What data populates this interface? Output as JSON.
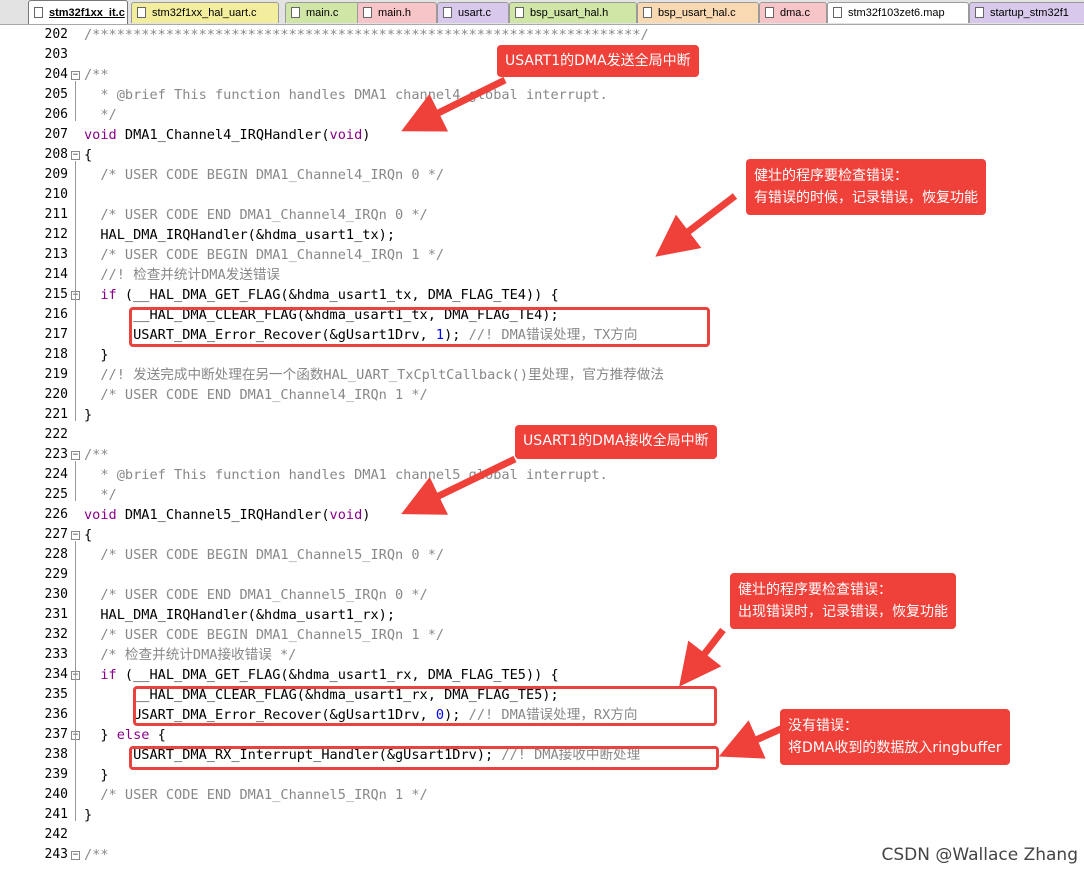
{
  "tabs": [
    {
      "label": "stm32f1xx_it.c",
      "active": true,
      "color": "#ffffff"
    },
    {
      "label": "stm32f1xx_hal_uart.c",
      "active": false,
      "color": "#f3ee9d"
    },
    {
      "label": "main.c",
      "active": false,
      "color": "#cfe6a6"
    },
    {
      "label": "main.h",
      "active": false,
      "color": "#f7c4c8"
    },
    {
      "label": "usart.c",
      "active": false,
      "color": "#d8c8ec"
    },
    {
      "label": "bsp_usart_hal.h",
      "active": false,
      "color": "#cfe6a6"
    },
    {
      "label": "bsp_usart_hal.c",
      "active": false,
      "color": "#f9d9b2"
    },
    {
      "label": "dma.c",
      "active": false,
      "color": "#f7c4c8"
    },
    {
      "label": "stm32f103zet6.map",
      "active": false,
      "color": "#ffffff"
    },
    {
      "label": "startup_stm32f1",
      "active": false,
      "color": "#d8c8ec"
    }
  ],
  "lines": [
    {
      "n": "202",
      "t": [
        [
          "cm",
          "/*******************************************************************/"
        ]
      ]
    },
    {
      "n": "203",
      "t": []
    },
    {
      "n": "204",
      "t": [
        [
          "cm",
          "/**"
        ]
      ],
      "fold": true
    },
    {
      "n": "205",
      "t": [
        [
          "cm",
          "  * @brief This function handles DMA1 channel4 global interrupt."
        ]
      ]
    },
    {
      "n": "206",
      "t": [
        [
          "cm",
          "  */"
        ]
      ]
    },
    {
      "n": "207",
      "t": [
        [
          "kw",
          "void"
        ],
        [
          "",
          " DMA1_Channel4_IRQHandler("
        ],
        [
          "kw",
          "void"
        ],
        [
          "",
          ")"
        ]
      ]
    },
    {
      "n": "208",
      "t": [
        [
          "",
          "{"
        ]
      ],
      "fold": true
    },
    {
      "n": "209",
      "t": [
        [
          "cm",
          "  /* USER CODE BEGIN DMA1_Channel4_IRQn 0 */"
        ]
      ]
    },
    {
      "n": "210",
      "t": []
    },
    {
      "n": "211",
      "t": [
        [
          "cm",
          "  /* USER CODE END DMA1_Channel4_IRQn 0 */"
        ]
      ]
    },
    {
      "n": "212",
      "t": [
        [
          "",
          "  HAL_DMA_IRQHandler(&hdma_usart1_tx);"
        ]
      ]
    },
    {
      "n": "213",
      "t": [
        [
          "cm",
          "  /* USER CODE BEGIN DMA1_Channel4_IRQn 1 */"
        ]
      ]
    },
    {
      "n": "214",
      "t": [
        [
          "cm",
          "  //! 检查并统计DMA发送错误"
        ]
      ]
    },
    {
      "n": "215",
      "t": [
        [
          "kw",
          "  if"
        ],
        [
          "",
          " (__HAL_DMA_GET_FLAG(&hdma_usart1_tx, DMA_FLAG_TE4)) {"
        ]
      ],
      "fold": true
    },
    {
      "n": "216",
      "t": [
        [
          "",
          "      __HAL_DMA_CLEAR_FLAG(&hdma_usart1_tx, DMA_FLAG_TE4);"
        ]
      ]
    },
    {
      "n": "217",
      "t": [
        [
          "",
          "      USART_DMA_Error_Recover(&gUsart1Drv, "
        ],
        [
          "num",
          "1"
        ],
        [
          "",
          "); "
        ],
        [
          "cm",
          "//! DMA错误处理，TX方向"
        ]
      ]
    },
    {
      "n": "218",
      "t": [
        [
          "",
          "  }"
        ]
      ]
    },
    {
      "n": "219",
      "t": [
        [
          "cm",
          "  //! 发送完成中断处理在另一个函数HAL_UART_TxCpltCallback()里处理，官方推荐做法"
        ]
      ]
    },
    {
      "n": "220",
      "t": [
        [
          "cm",
          "  /* USER CODE END DMA1_Channel4_IRQn 1 */"
        ]
      ]
    },
    {
      "n": "221",
      "t": [
        [
          "",
          "}"
        ]
      ]
    },
    {
      "n": "222",
      "t": []
    },
    {
      "n": "223",
      "t": [
        [
          "cm",
          "/**"
        ]
      ],
      "fold": true
    },
    {
      "n": "224",
      "t": [
        [
          "cm",
          "  * @brief This function handles DMA1 channel5 global interrupt."
        ]
      ]
    },
    {
      "n": "225",
      "t": [
        [
          "cm",
          "  */"
        ]
      ]
    },
    {
      "n": "226",
      "t": [
        [
          "kw",
          "void"
        ],
        [
          "",
          " DMA1_Channel5_IRQHandler("
        ],
        [
          "kw",
          "void"
        ],
        [
          "",
          ")"
        ]
      ]
    },
    {
      "n": "227",
      "t": [
        [
          "",
          "{"
        ]
      ],
      "fold": true
    },
    {
      "n": "228",
      "t": [
        [
          "cm",
          "  /* USER CODE BEGIN DMA1_Channel5_IRQn 0 */"
        ]
      ]
    },
    {
      "n": "229",
      "t": []
    },
    {
      "n": "230",
      "t": [
        [
          "cm",
          "  /* USER CODE END DMA1_Channel5_IRQn 0 */"
        ]
      ]
    },
    {
      "n": "231",
      "t": [
        [
          "",
          "  HAL_DMA_IRQHandler(&hdma_usart1_rx);"
        ]
      ]
    },
    {
      "n": "232",
      "t": [
        [
          "cm",
          "  /* USER CODE BEGIN DMA1_Channel5_IRQn 1 */"
        ]
      ]
    },
    {
      "n": "233",
      "t": [
        [
          "cm",
          "  /* 检查并统计DMA接收错误 */"
        ]
      ]
    },
    {
      "n": "234",
      "t": [
        [
          "kw",
          "  if"
        ],
        [
          "",
          " (__HAL_DMA_GET_FLAG(&hdma_usart1_rx, DMA_FLAG_TE5)) {"
        ]
      ],
      "fold": true
    },
    {
      "n": "235",
      "t": [
        [
          "",
          "      __HAL_DMA_CLEAR_FLAG(&hdma_usart1_rx, DMA_FLAG_TE5);"
        ]
      ]
    },
    {
      "n": "236",
      "t": [
        [
          "",
          "      USART_DMA_Error_Recover(&gUsart1Drv, "
        ],
        [
          "num",
          "0"
        ],
        [
          "",
          "); "
        ],
        [
          "cm",
          "//! DMA错误处理，RX方向"
        ]
      ]
    },
    {
      "n": "237",
      "t": [
        [
          "",
          "  } "
        ],
        [
          "kw",
          "else"
        ],
        [
          "",
          " {"
        ]
      ],
      "fold": true
    },
    {
      "n": "238",
      "t": [
        [
          "",
          "      USART_DMA_RX_Interrupt_Handler(&gUsart1Drv); "
        ],
        [
          "cm",
          "//! DMA接收中断处理"
        ]
      ]
    },
    {
      "n": "239",
      "t": [
        [
          "",
          "  }"
        ]
      ]
    },
    {
      "n": "240",
      "t": [
        [
          "cm",
          "  /* USER CODE END DMA1_Channel5_IRQn 1 */"
        ]
      ]
    },
    {
      "n": "241",
      "t": [
        [
          "",
          "}"
        ]
      ]
    },
    {
      "n": "242",
      "t": []
    },
    {
      "n": "243",
      "t": [
        [
          "cm",
          "/**"
        ]
      ],
      "fold": true
    }
  ],
  "callouts": {
    "tx_irq": "USART1的DMA发送全局中断",
    "tx_error_l1": "健壮的程序要检查错误：",
    "tx_error_l2": "有错误的时候，记录错误，恢复功能",
    "rx_irq": "USART1的DMA接收全局中断",
    "rx_error_l1": "健壮的程序要检查错误：",
    "rx_error_l2": "出现错误时，记录错误，恢复功能",
    "no_error_l1": "没有错误：",
    "no_error_l2": "将DMA收到的数据放入ringbuffer"
  },
  "watermark": "CSDN @Wallace Zhang",
  "colors": {
    "annotation": "#f0403a",
    "keyword": "#8b008b",
    "comment": "#888888",
    "number": "#0000ff"
  }
}
